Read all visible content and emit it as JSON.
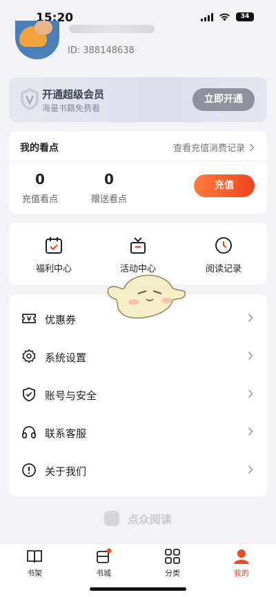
{
  "status": {
    "time": "15:20",
    "battery": "34"
  },
  "profile": {
    "user_id": "ID: 388148638"
  },
  "vip": {
    "title": "开通超级会员",
    "subtitle": "海量书籍免费看",
    "button": "立即开通"
  },
  "points": {
    "title": "我的看点",
    "history_link": "查看充值消费记录",
    "recharge_points_value": "0",
    "recharge_points_label": "充值看点",
    "gift_points_value": "0",
    "gift_points_label": "赠送看点",
    "recharge_button": "充值"
  },
  "shortcuts": [
    {
      "label": "福利中心",
      "icon": "calendar-check-icon"
    },
    {
      "label": "活动中心",
      "icon": "gift-box-icon"
    },
    {
      "label": "阅读记录",
      "icon": "clock-icon"
    }
  ],
  "menu": [
    {
      "label": "优惠券",
      "icon": "coupon-icon"
    },
    {
      "label": "系统设置",
      "icon": "gear-icon"
    },
    {
      "label": "账号与安全",
      "icon": "shield-check-icon"
    },
    {
      "label": "联系客服",
      "icon": "headphones-icon"
    },
    {
      "label": "关于我们",
      "icon": "info-icon"
    }
  ],
  "brand": "点众阅读",
  "tabs": [
    {
      "label": "书架",
      "icon": "bookshelf-icon"
    },
    {
      "label": "书城",
      "icon": "bookstore-icon"
    },
    {
      "label": "分类",
      "icon": "category-icon"
    },
    {
      "label": "我的",
      "icon": "user-icon"
    }
  ],
  "colors": {
    "accent": "#f04a22",
    "vip_button": "#8f929e",
    "background": "#f3f3f5"
  }
}
